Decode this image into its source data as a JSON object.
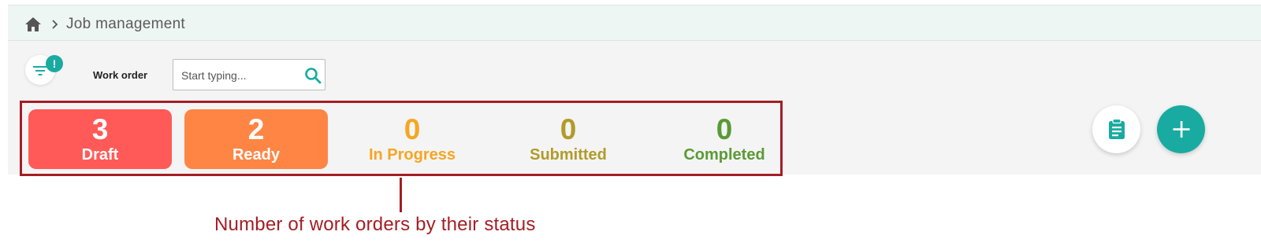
{
  "breadcrumb": {
    "home_icon": "home-icon",
    "separator_icon": "chevron-right-icon",
    "title": "Job management"
  },
  "filters": {
    "filter_icon": "filter-list-icon",
    "badge": "!",
    "work_order_label": "Work order",
    "search_placeholder": "Start typing...",
    "search_value": ""
  },
  "status_summary": [
    {
      "count": "3",
      "label": "Draft",
      "bg": "#ff5a57",
      "text_color": "#ffffff"
    },
    {
      "count": "2",
      "label": "Ready",
      "bg": "#ff8545",
      "text_color": "#ffffff"
    },
    {
      "count": "0",
      "label": "In Progress",
      "bg": "transparent",
      "text_color": "#f5a623"
    },
    {
      "count": "0",
      "label": "Submitted",
      "bg": "transparent",
      "text_color": "#b19b2a"
    },
    {
      "count": "0",
      "label": "Completed",
      "bg": "transparent",
      "text_color": "#5a9a36"
    }
  ],
  "actions": {
    "clipboard_icon": "clipboard-icon",
    "add_icon": "plus-icon"
  },
  "annotation": {
    "text": "Number of work orders by their status"
  },
  "colors": {
    "accent": "#19aba1",
    "annotation": "#a51d24"
  }
}
